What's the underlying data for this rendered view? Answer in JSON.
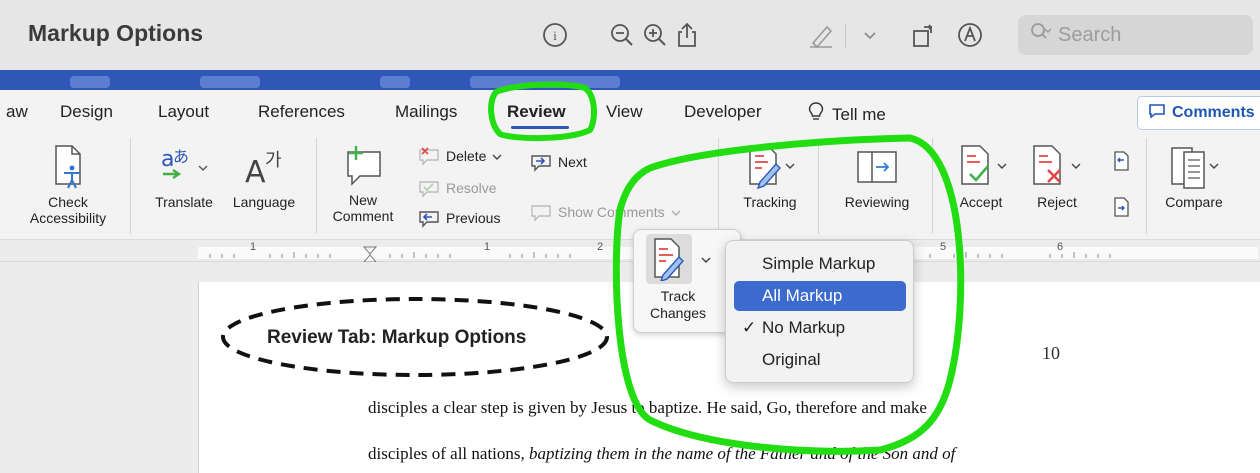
{
  "window": {
    "title": "Markup Options",
    "search_placeholder": "Search",
    "toolbar_icons": [
      "info-icon",
      "zoom-out-icon",
      "zoom-in-icon",
      "share-icon",
      "highlighter-icon",
      "chevron-down-icon",
      "rotate-icon",
      "markup-icon"
    ]
  },
  "ribbon_tabs": [
    {
      "label": "aw"
    },
    {
      "label": "Design"
    },
    {
      "label": "Layout"
    },
    {
      "label": "References"
    },
    {
      "label": "Mailings"
    },
    {
      "label": "Review",
      "active": true
    },
    {
      "label": "View"
    },
    {
      "label": "Developer"
    },
    {
      "label": "Tell me"
    }
  ],
  "comments_button": "Comments",
  "ribbon": {
    "check_accessibility": "Check Accessibility",
    "translate": "Translate",
    "language": "Language",
    "new_comment_line1": "New",
    "new_comment_line2": "Comment",
    "delete": "Delete",
    "resolve": "Resolve",
    "previous": "Previous",
    "next": "Next",
    "show_comments": "Show Comments",
    "tracking": "Tracking",
    "reviewing": "Reviewing",
    "accept": "Accept",
    "reject": "Reject",
    "compare": "Compare"
  },
  "ruler": {
    "numbers": [
      "1",
      "1",
      "2",
      "5",
      "6"
    ]
  },
  "track_changes": {
    "line1": "Track",
    "line2": "Changes"
  },
  "markup_menu": {
    "items": [
      {
        "label": "Simple Markup"
      },
      {
        "label": "All Markup",
        "highlighted": true
      },
      {
        "label": "No Markup",
        "checked": true
      },
      {
        "label": "Original"
      }
    ],
    "check_mark": "✓"
  },
  "callout": "Review Tab: Markup Options",
  "document": {
    "page_number": "10",
    "line1": "disciples a clear step is given by Jesus to baptize. He said, Go, therefore and make",
    "line2_plain": "disciples of all nations, ",
    "line2_italic": "baptizing them in the name of the Father and of the Son and of"
  },
  "colors": {
    "accent_blue": "#2f57b7",
    "menu_highlight": "#3c6bcd",
    "annotation_green": "#22dd11",
    "icon_red": "#e04848",
    "icon_green": "#44b04a"
  }
}
